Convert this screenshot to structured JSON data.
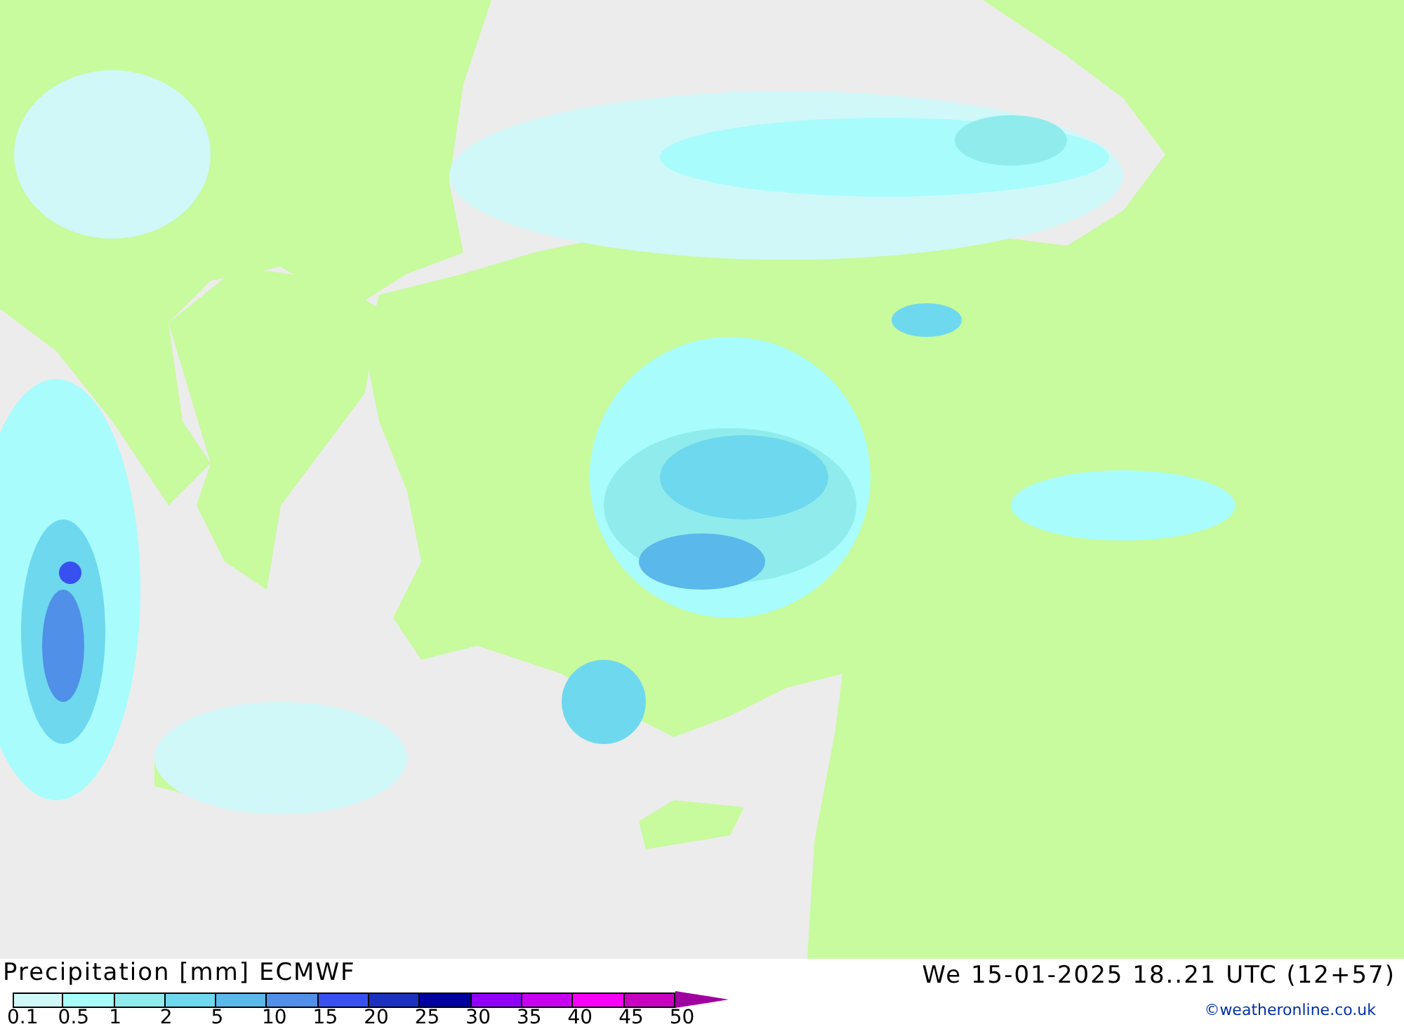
{
  "title": "Precipitation [mm] ECMWF",
  "valid_time": "We 15-01-2025 18..21 UTC (12+57)",
  "credit": "©weatheronline.co.uk",
  "legend": {
    "bins": [
      {
        "color": "#d0f8f8"
      },
      {
        "color": "#a8fcfc"
      },
      {
        "color": "#90ecec"
      },
      {
        "color": "#6ed8ee"
      },
      {
        "color": "#5ab8ea"
      },
      {
        "color": "#5090e8"
      },
      {
        "color": "#3850f0"
      },
      {
        "color": "#1c30c0"
      },
      {
        "color": "#0000a0"
      },
      {
        "color": "#9000f8"
      },
      {
        "color": "#c800f0"
      },
      {
        "color": "#f800f8"
      },
      {
        "color": "#c800c0"
      },
      {
        "color": "#a000a0",
        "kind": "arrow"
      }
    ],
    "labels": [
      "0.1",
      "0.5",
      "1",
      "2",
      "5",
      "10",
      "15",
      "20",
      "25",
      "30",
      "35",
      "40",
      "45",
      "50"
    ]
  }
}
